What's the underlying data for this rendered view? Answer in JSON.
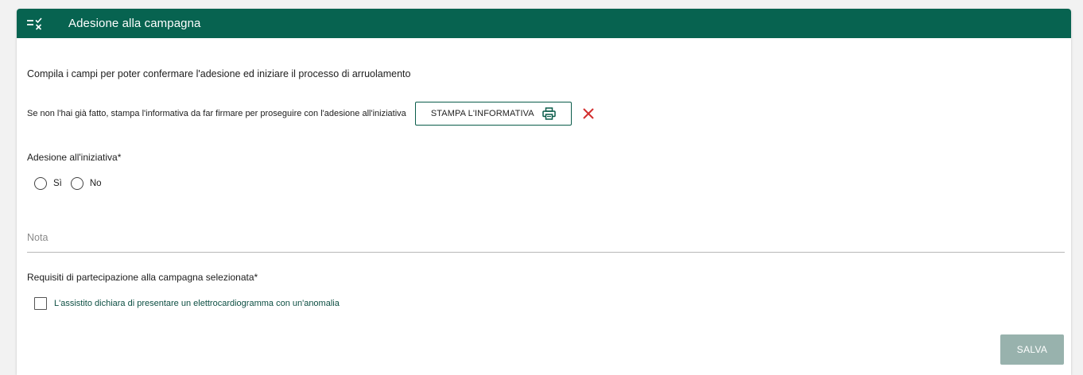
{
  "header": {
    "icon": "checklist-icon",
    "title": "Adesione alla campagna",
    "background_color": "#076350"
  },
  "intro_text": "Compila i campi per poter confermare l'adesione ed iniziare il processo di arruolamento",
  "print_section": {
    "text": "Se non l'hai già fatto, stampa l'informativa da far firmare per proseguire con l'adesione all'iniziativa",
    "button_label": "STAMPA L'INFORMATIVA",
    "button_icon": "printer-icon",
    "status_icon": "close-icon",
    "status_color": "#d32f2f"
  },
  "adesione": {
    "label": "Adesione all'iniziativa*",
    "options": [
      {
        "label": "Sì",
        "selected": false
      },
      {
        "label": "No",
        "selected": false
      }
    ]
  },
  "nota": {
    "placeholder": "Nota",
    "value": ""
  },
  "requisiti": {
    "label": "Requisiti di partecipazione alla campagna selezionata*",
    "checkbox_label": "L'assistito dichiara di presentare un elettrocardiogramma con un'anomalia",
    "checked": false
  },
  "save_button": {
    "label": "SALVA",
    "disabled": true,
    "color": "#98b2ad"
  }
}
